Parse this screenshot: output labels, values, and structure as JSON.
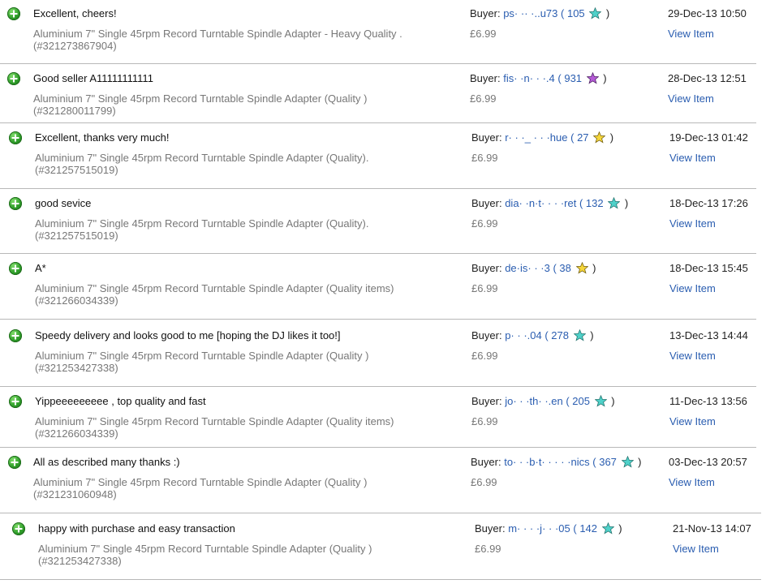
{
  "buyer_prefix": "Buyer:",
  "view_label": "View Item",
  "star_colors": {
    "turquoise": "#4fd1c9",
    "purple": "#b45bd6",
    "yellow": "#f5d63b"
  },
  "rows": [
    {
      "comment": "Excellent, cheers!",
      "title": "Aluminium 7\" Single 45rpm Record Turntable Spindle Adapter - Heavy Quality .",
      "item_number": "(#321273867904)",
      "buyer": "ps· ·· ·..u73",
      "score": "105",
      "star": "turquoise-star",
      "price": "£6.99",
      "date": "29-Dec-13 10:50"
    },
    {
      "comment": "Good seller A11111111111",
      "title": "Aluminium 7\" Single 45rpm Record Turntable Spindle Adapter (Quality )",
      "item_number": "(#321280011799)",
      "buyer": "fis· ·n· · ·.4",
      "score": "931",
      "star": "purple-star",
      "price": "£6.99",
      "date": "28-Dec-13 12:51"
    },
    {
      "comment": "Excellent, thanks very much!",
      "title": "Aluminium 7\" Single 45rpm Record Turntable Spindle Adapter (Quality).",
      "item_number": "(#321257515019)",
      "buyer": "r· · ·_ · · ·hue",
      "score": "27",
      "star": "yellow-star",
      "price": "£6.99",
      "date": "19-Dec-13 01:42"
    },
    {
      "comment": "good sevice",
      "title": "Aluminium 7\" Single 45rpm Record Turntable Spindle Adapter (Quality).",
      "item_number": "(#321257515019)",
      "buyer": "dia· ·n·t· · · ·ret",
      "score": "132",
      "star": "turquoise-star",
      "price": "£6.99",
      "date": "18-Dec-13 17:26"
    },
    {
      "comment": "A*",
      "title": "Aluminium 7\" Single 45rpm Record Turntable Spindle Adapter (Quality items)",
      "item_number": "(#321266034339)",
      "buyer": "de·is· · ·3",
      "score": "38",
      "star": "yellow-star",
      "price": "£6.99",
      "date": "18-Dec-13 15:45"
    },
    {
      "comment": "Speedy delivery and looks good to me [hoping the DJ likes it too!]",
      "title": "Aluminium 7\" Single 45rpm Record Turntable Spindle Adapter (Quality )",
      "item_number": "(#321253427338)",
      "buyer": "p· · ·.04",
      "score": "278",
      "star": "turquoise-star",
      "price": "£6.99",
      "date": "13-Dec-13 14:44"
    },
    {
      "comment": "Yippeeeeeeeee , top quality and fast",
      "title": "Aluminium 7\" Single 45rpm Record Turntable Spindle Adapter (Quality items)",
      "item_number": "(#321266034339)",
      "buyer": "jo· · ·th· ·.en",
      "score": "205",
      "star": "turquoise-star",
      "price": "£6.99",
      "date": "11-Dec-13 13:56"
    },
    {
      "comment": "All as described many thanks :)",
      "title": "Aluminium 7\" Single 45rpm Record Turntable Spindle Adapter (Quality )",
      "item_number": "(#321231060948)",
      "buyer": "to· · ·b·t· · · · ·nics",
      "score": "367",
      "star": "turquoise-star",
      "price": "£6.99",
      "date": "03-Dec-13 20:57"
    },
    {
      "comment": "happy with purchase and easy transaction",
      "title": "Aluminium 7\" Single 45rpm Record Turntable Spindle Adapter (Quality )",
      "item_number": "(#321253427338)",
      "buyer": "m· · · ·j· · ·05",
      "score": "142",
      "star": "turquoise-star",
      "price": "£6.99",
      "date": "21-Nov-13 14:07"
    }
  ]
}
